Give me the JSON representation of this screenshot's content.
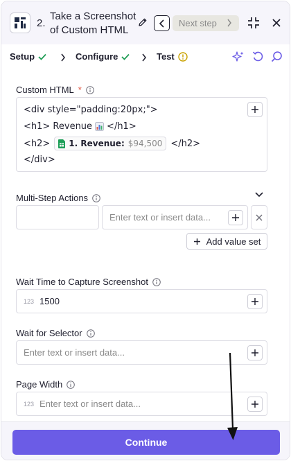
{
  "header": {
    "step_number": "2.",
    "step_title": "Take a Screenshot of Custom HTML",
    "next_step_label": "Next step",
    "icons": [
      "app-logo-icon",
      "pencil-icon",
      "chevron-left-icon",
      "chevron-right-icon",
      "collapse-icon",
      "close-icon"
    ]
  },
  "tabs": [
    {
      "label": "Setup",
      "status": "complete"
    },
    {
      "label": "Configure",
      "status": "complete"
    },
    {
      "label": "Test",
      "status": "warning"
    }
  ],
  "colors": {
    "accent": "#6b5ce6",
    "success": "#1f9d55",
    "warning": "#c9a200",
    "required": "#e0513d",
    "header_bg": "#f6f5fb"
  },
  "custom_html": {
    "label": "Custom HTML",
    "required_mark": "*",
    "line1": "<div style=\"padding:20px;\">",
    "line2_prefix": "<h1> Revenue",
    "line2_suffix": "</h1>",
    "line3_prefix": "<h2>",
    "pill_label": "1. Revenue:",
    "pill_value": "$94,500",
    "line3_suffix": "</h2>",
    "line4": "</div>"
  },
  "multi_step": {
    "label": "Multi-Step Actions",
    "key_value": "",
    "value_placeholder": "Enter text or insert data...",
    "add_value_set_label": "Add value set"
  },
  "wait_time": {
    "label": "Wait Time to Capture Screenshot",
    "type_badge": "123",
    "value": "1500"
  },
  "wait_selector": {
    "label": "Wait for Selector",
    "placeholder": "Enter text or insert data..."
  },
  "page_width": {
    "label": "Page Width",
    "type_badge": "123",
    "placeholder": "Enter text or insert data..."
  },
  "footer": {
    "continue_label": "Continue"
  }
}
